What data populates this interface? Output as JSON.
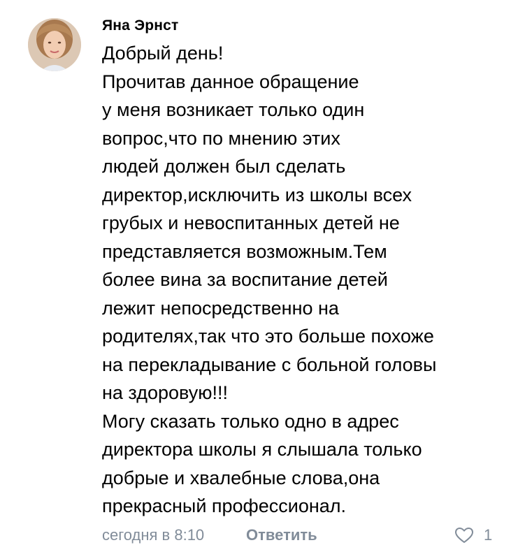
{
  "comment": {
    "author": "Яна Эрнст",
    "text_lines": [
      "Добрый день!",
      "Прочитав данное обращение",
      "у меня возникает только один",
      "вопрос,что по мнению этих",
      "людей должен был сделать",
      "директор,исключить из школы всех",
      "грубых и невоспитанных детей не",
      "представляется возможным.Тем",
      "более вина за воспитание детей",
      "лежит непосредственно на",
      "родителях,так что это больше похоже",
      "на перекладывание с больной головы",
      "на здоровую!!!",
      "Могу сказать только одно в адрес",
      "директора школы я слышала только",
      "добрые и хвалебные слова,она",
      "прекрасный профессионал."
    ],
    "timestamp": "сегодня в 8:10",
    "reply_label": "Ответить",
    "like_count": "1",
    "avatar_icon": "user-avatar-photo",
    "like_icon": "heart-outline-icon"
  },
  "colors": {
    "text": "#000000",
    "meta": "#818c99",
    "background": "#ffffff"
  }
}
